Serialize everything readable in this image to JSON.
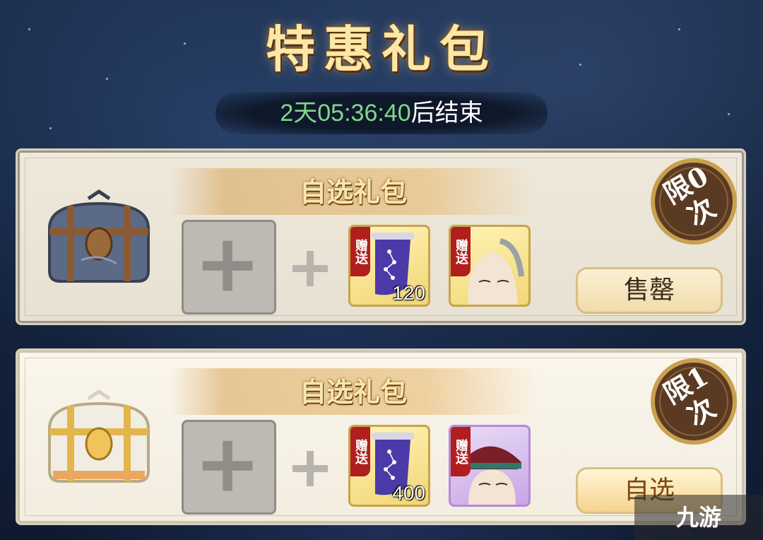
{
  "header": {
    "title": "特惠礼包",
    "timer_value": "2天05:36:40",
    "timer_suffix": "后结束"
  },
  "packs": [
    {
      "title": "自选礼包",
      "limit": "限0次",
      "limit_line1": "限0",
      "limit_line2": "次",
      "gift_tag": "赠送",
      "gift_tag2": "赠送",
      "gift_qty": "120",
      "button_label": "售罄",
      "chest_style": "iron-blue",
      "hero_icon": "bald-hero-portrait"
    },
    {
      "title": "自选礼包",
      "limit": "限1次",
      "limit_line1": "限1",
      "limit_line2": "次",
      "gift_tag": "赠送",
      "gift_tag2": "赠送",
      "gift_qty": "400",
      "button_label": "自选",
      "chest_style": "gold-white",
      "hero_icon": "crowned-hero-portrait"
    }
  ],
  "watermark": {
    "text": "九游"
  },
  "colors": {
    "timer_green": "#7fd88a",
    "title_gold": "#fbe7a6",
    "gift_tag_red": "#b01e1e"
  }
}
